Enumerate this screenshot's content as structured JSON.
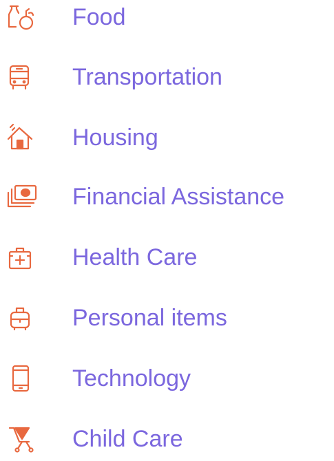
{
  "accent_color": "#e8683f",
  "label_color": "#7b67de",
  "categories": [
    {
      "label": "Food",
      "icon": "food-icon"
    },
    {
      "label": "Transportation",
      "icon": "bus-icon"
    },
    {
      "label": "Housing",
      "icon": "house-icon"
    },
    {
      "label": "Financial Assistance",
      "icon": "money-icon"
    },
    {
      "label": "Health Care",
      "icon": "first-aid-kit-icon"
    },
    {
      "label": "Personal items",
      "icon": "luggage-icon"
    },
    {
      "label": "Technology",
      "icon": "phone-icon"
    },
    {
      "label": "Child Care",
      "icon": "stroller-icon"
    }
  ]
}
